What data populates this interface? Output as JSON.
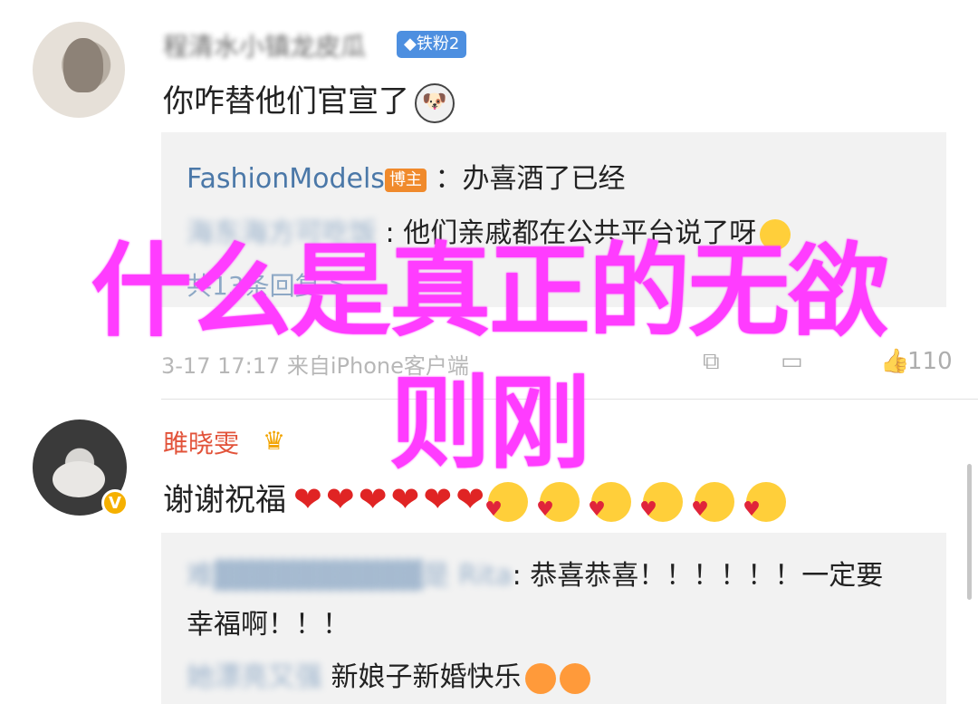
{
  "comment1": {
    "username": "程清水小镇龙皮瓜",
    "level_badge": "◆铁粉2",
    "text": "你咋替他们官宣了",
    "emoji": "husky-emoji",
    "replies": [
      {
        "name": "FashionModels",
        "badge": "博主",
        "text": "：办喜酒了已经"
      },
      {
        "name": "海东海方可吃饭",
        "text": ": 他们亲戚都在公共平台说了呀"
      }
    ],
    "more_replies": "共13条回复 >",
    "meta": "3-17 17:17 来自iPhone客户端",
    "actions": {
      "share": "share-icon",
      "comment": "comment-icon",
      "like_count": "110"
    }
  },
  "comment2": {
    "username": "雎晓雯",
    "verified": "V",
    "text": "谢谢祝福",
    "hearts": 6,
    "kiss_faces": 6,
    "replies": [
      {
        "name": "难▓▓▓▓▓▓▓▓▓▓是 Rita",
        "text": ": 恭喜恭喜！！！！！！一定要",
        "text_cont": "幸福啊！！！"
      },
      {
        "name": "她漂亮又强",
        "text": "新娘子新婚快乐"
      }
    ]
  },
  "overlay": {
    "line1": "什么是真正的无欲",
    "line2": "则刚"
  },
  "colors": {
    "overlay": "#ff3cff",
    "link": "#4b78a8",
    "vip_name": "#e2533a"
  }
}
